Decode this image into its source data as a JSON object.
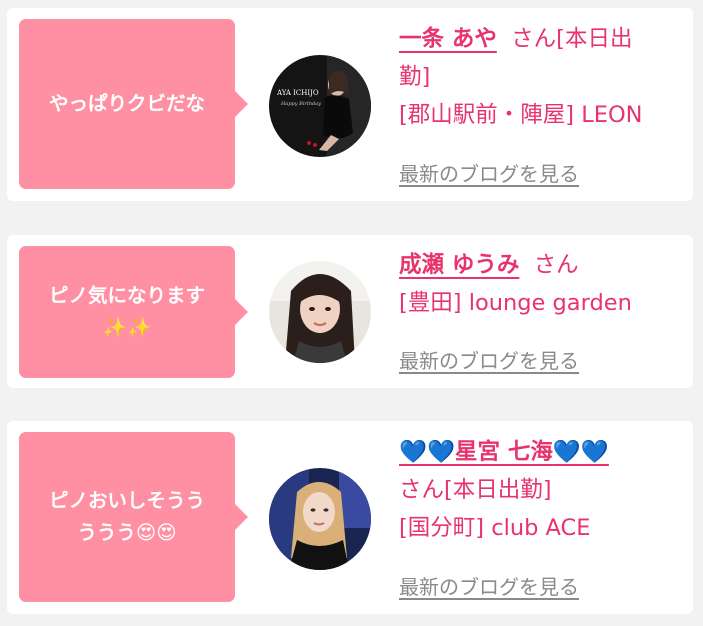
{
  "colors": {
    "bubble": "#ff8fa3",
    "accent": "#e8336d",
    "link": "#8a8a8a",
    "card": "#ffffff",
    "background": "#f2f2f2"
  },
  "entries": [
    {
      "comment": "やっぱりクビだな",
      "cast_name": "一条 あや",
      "honorific": "さん",
      "status_1": "[本日出",
      "status_2": "勤]",
      "shop": "[郡山駅前・陣屋] LEON",
      "blog_link": "最新のブログを見る",
      "avatar_icon": "cast-photo-icon",
      "avatar_text_1": "AYA ICHIJO",
      "avatar_text_2": "Happy Birthday"
    },
    {
      "comment_1": "ピノ気になります",
      "comment_2": "✨✨",
      "cast_name": "成瀬 ゆうみ",
      "honorific": "さん",
      "shop": "[豊田] lounge garden",
      "blog_link": "最新のブログを見る",
      "avatar_icon": "cast-photo-icon"
    },
    {
      "comment_1": "ピノおいしそうう",
      "comment_2": "ううう😍😍",
      "name_prefix": "💙💙",
      "cast_name": "星宮 七海",
      "name_suffix": "💙💙",
      "honorific_status": "さん[本日出勤]",
      "shop": "[国分町] club ACE",
      "blog_link": "最新のブログを見る",
      "avatar_icon": "cast-photo-icon"
    }
  ]
}
